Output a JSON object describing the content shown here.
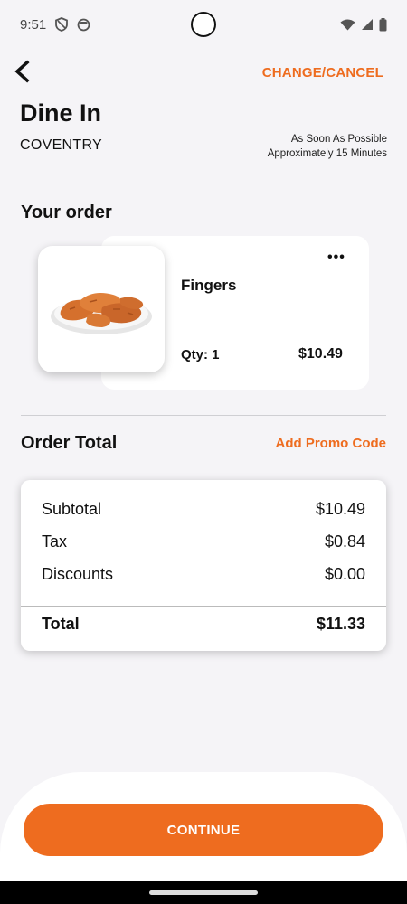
{
  "status_bar": {
    "time": "9:51",
    "icons": [
      "shield-icon",
      "face-icon",
      "wifi-icon",
      "signal-icon",
      "battery-icon"
    ]
  },
  "header": {
    "change_cancel": "CHANGE/CANCEL",
    "title": "Dine In",
    "location": "COVENTRY",
    "timing_line1": "As Soon As Possible",
    "timing_line2": "Approximately 15 Minutes"
  },
  "order": {
    "section_title": "Your order",
    "items": [
      {
        "name": "Fingers",
        "qty": "Qty: 1",
        "price": "$10.49",
        "more": "•••"
      }
    ]
  },
  "order_total": {
    "label": "Order Total",
    "promo": "Add Promo Code",
    "rows": [
      {
        "label": "Subtotal",
        "value": "$10.49"
      },
      {
        "label": "Tax",
        "value": "$0.84"
      },
      {
        "label": "Discounts",
        "value": "$0.00"
      }
    ],
    "total_label": "Total",
    "total_value": "$11.33"
  },
  "footer": {
    "continue_label": "CONTINUE"
  },
  "colors": {
    "accent": "#ee6c1f",
    "background": "#f5f4f7"
  }
}
